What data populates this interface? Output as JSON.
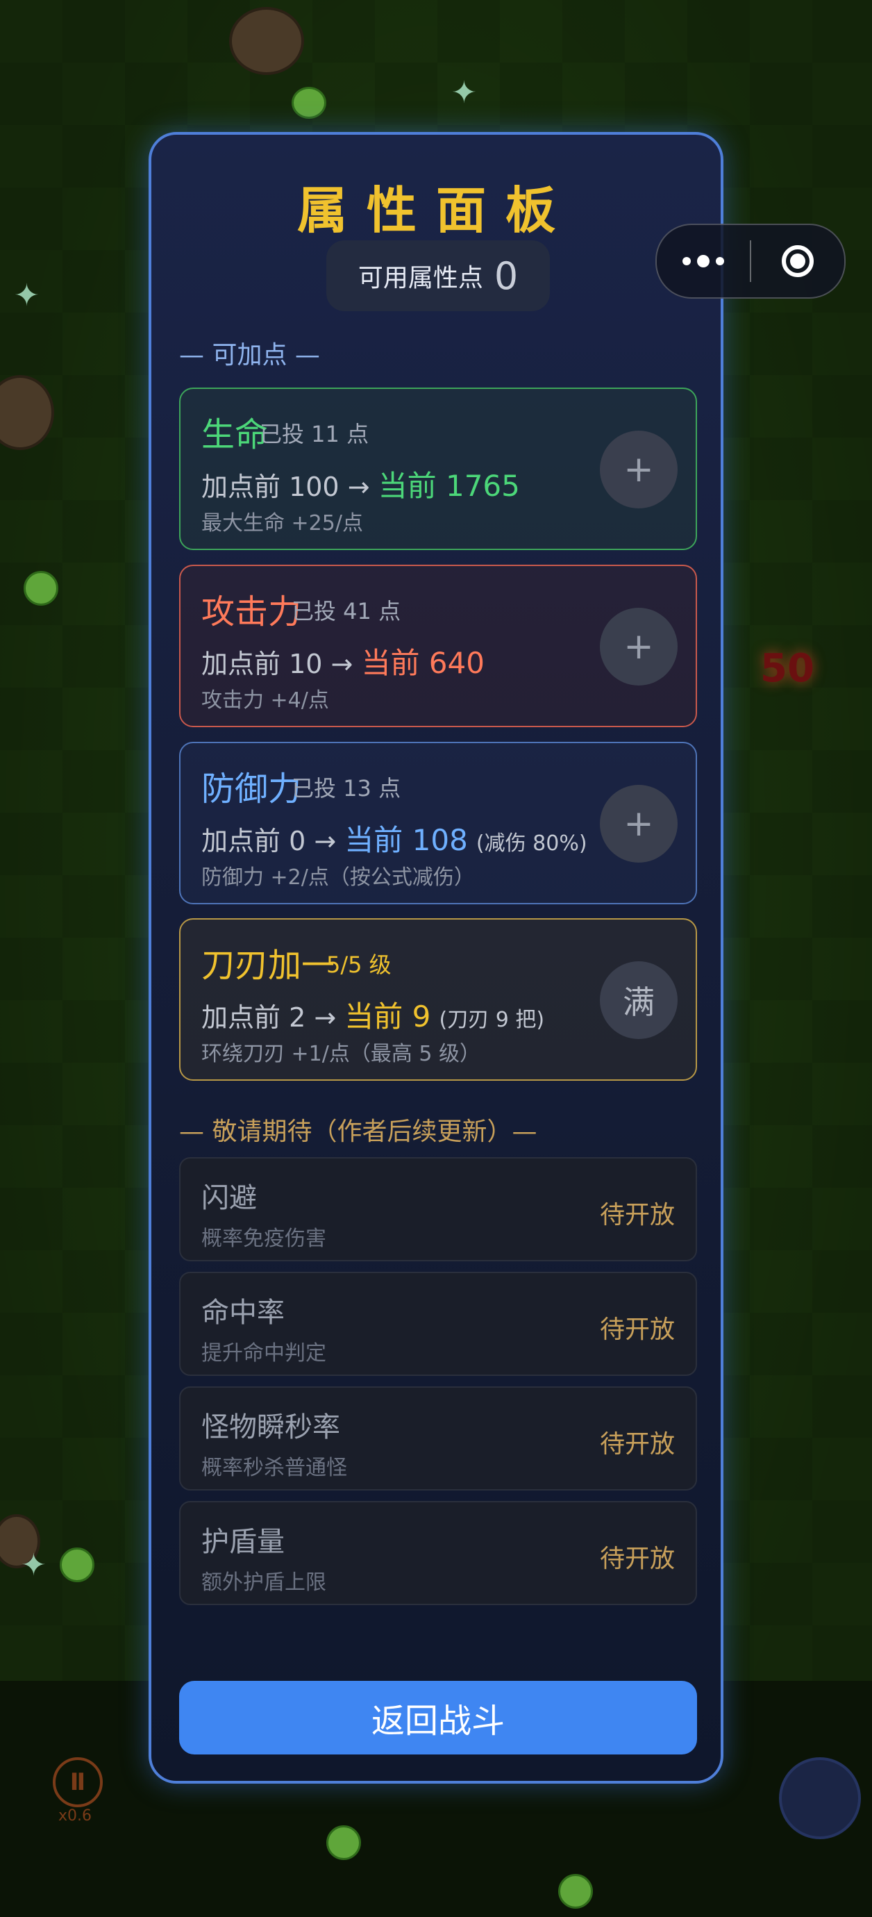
{
  "capsule": {
    "more_icon": "more-dots-icon",
    "close_icon": "target-close-icon"
  },
  "panel": {
    "title": "属性面板",
    "points_label": "可用属性点",
    "points_value": "0",
    "section_available": "— 可加点 —",
    "section_coming": "— 敬请期待（作者后续更新）—",
    "return_label": "返回战斗"
  },
  "attributes": [
    {
      "name": "生命",
      "invested": "已投 11 点",
      "before": "加点前 100 →",
      "current": "当前 1765",
      "note": "",
      "desc": "最大生命 +25/点",
      "button": "+",
      "color": "#4cd779"
    },
    {
      "name": "攻击力",
      "invested": "已投 41 点",
      "before": "加点前 10 →",
      "current": "当前 640",
      "note": "",
      "desc": "攻击力 +4/点",
      "button": "+",
      "color": "#ff7a5a"
    },
    {
      "name": "防御力",
      "invested": "已投 13 点",
      "before": "加点前 0 →",
      "current": "当前 108",
      "note": "(减伤 80%)",
      "desc": "防御力 +2/点（按公式减伤）",
      "button": "+",
      "color": "#6fb0ff"
    },
    {
      "name": "刀刃加一",
      "invested": "5/5 级",
      "before": "加点前 2 →",
      "current": "当前 9",
      "note": "(刀刃 9 把)",
      "desc": "环绕刀刃 +1/点（最高 5 级）",
      "button": "满",
      "color": "#f0c22e"
    }
  ],
  "coming_soon": [
    {
      "name": "闪避",
      "desc": "概率免疫伤害",
      "status": "待开放"
    },
    {
      "name": "命中率",
      "desc": "提升命中判定",
      "status": "待开放"
    },
    {
      "name": "怪物瞬秒率",
      "desc": "概率秒杀普通怪",
      "status": "待开放"
    },
    {
      "name": "护盾量",
      "desc": "额外护盾上限",
      "status": "待开放"
    }
  ],
  "game": {
    "float_damage": "50",
    "pause_icon": "pause-icon",
    "speed_label": "x0.6"
  },
  "colors": {
    "panel_border": "#4f7fd9",
    "title": "#f0c22e",
    "return_button": "#3f86f2",
    "coming_status": "#c8a05a"
  }
}
